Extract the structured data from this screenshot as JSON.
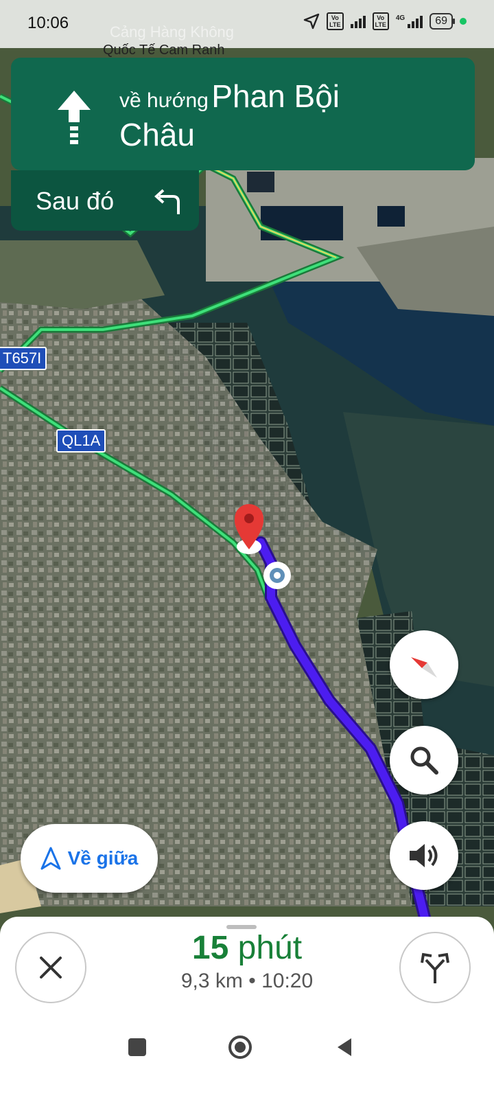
{
  "status_bar": {
    "time": "10:06",
    "battery": "69",
    "network": "4G",
    "volte": "Vo\nLTE"
  },
  "map": {
    "place_label_faded": "Cảng Hàng Không",
    "place_label": "Quốc Tế Cam Ranh",
    "road_shields": [
      "T657I",
      "QL1A"
    ]
  },
  "navigation": {
    "direction_prefix": "về hướng",
    "street_line1": "Phan Bội",
    "street_line2": "Châu",
    "then_label": "Sau đó"
  },
  "recenter": {
    "label": "Về giữa"
  },
  "trip": {
    "duration_value": "15",
    "duration_unit": "phút",
    "distance": "9,3 km",
    "separator": "•",
    "arrival": "10:20"
  },
  "colors": {
    "nav_green": "#10684e",
    "then_green": "#0c5540",
    "route_blue": "#4c1df0",
    "eta_green": "#188038"
  }
}
